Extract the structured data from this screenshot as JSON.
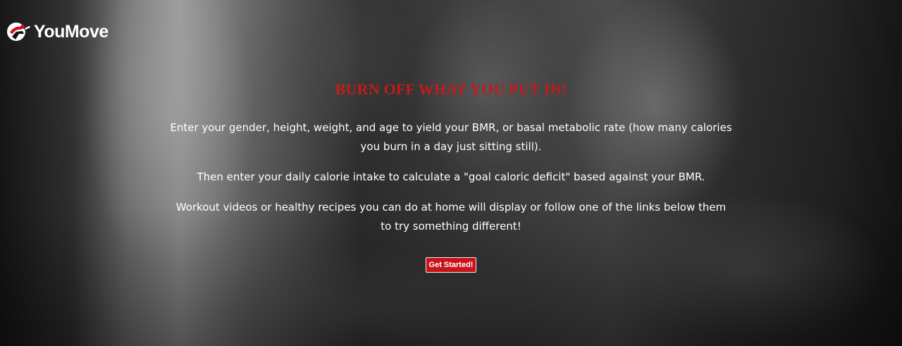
{
  "brand": {
    "name": "YouMove",
    "logo_icon": "runner-logo-icon"
  },
  "hero": {
    "headline": "BURN OFF WHAT YOU PUT IN!",
    "paragraphs": [
      "Enter your gender, height, weight, and age to yield your BMR, or basal metabolic rate (how many calories you burn in a day just sitting still).",
      "Then enter your daily calorie intake to calculate a \"goal caloric deficit\" based against your BMR.",
      "Workout videos or healthy recipes you can do at home will display or follow one of the links below them to try something different!"
    ],
    "cta_label": "Get Started!"
  },
  "colors": {
    "accent": "#c11b1b",
    "button": "#c8131b",
    "text": "#ffffff"
  }
}
